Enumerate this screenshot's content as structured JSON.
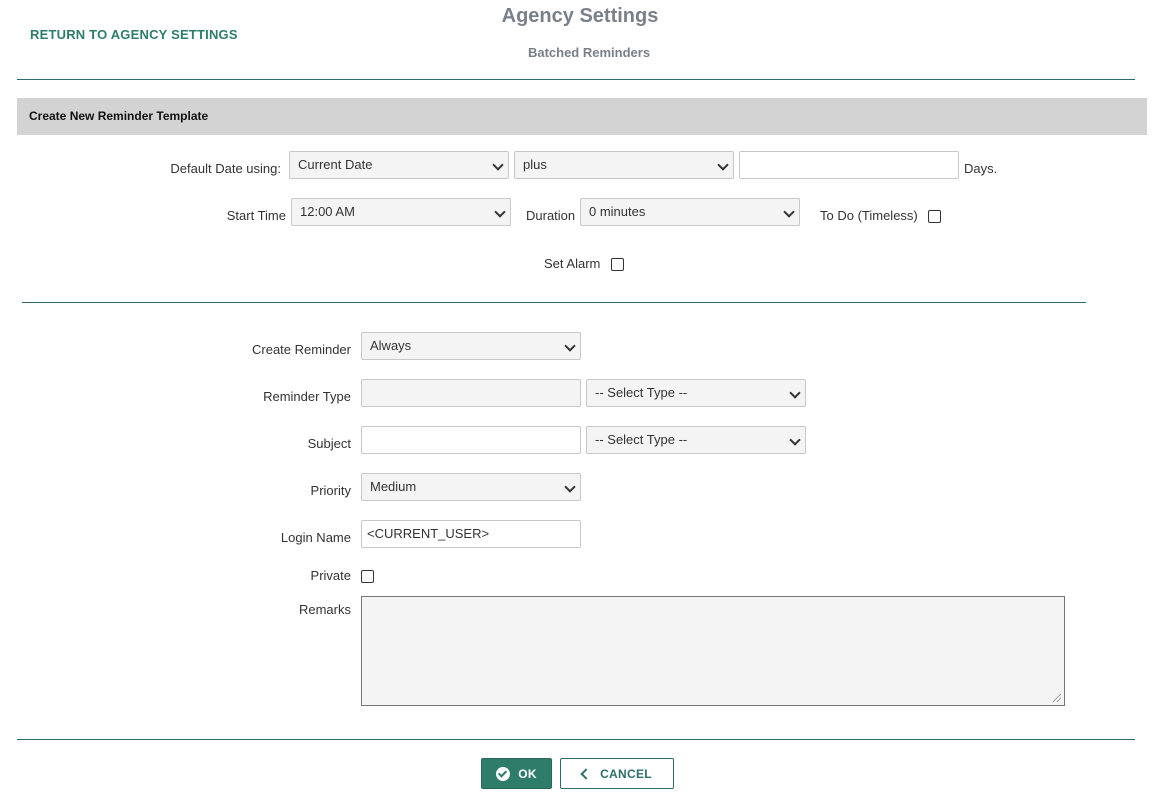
{
  "header": {
    "return_link": "RETURN TO AGENCY SETTINGS",
    "title": "Agency Settings",
    "subtitle": "Batched Reminders"
  },
  "section": {
    "title": "Create New Reminder Template"
  },
  "date_row": {
    "label": "Default Date using:",
    "date_source": "Current Date",
    "operator": "plus",
    "days_value": "",
    "days_suffix": "Days."
  },
  "time_row": {
    "start_label": "Start Time",
    "start_value": "12:00 AM",
    "duration_label": "Duration",
    "duration_value": "0 minutes",
    "todo_label": "To Do (Timeless)"
  },
  "alarm": {
    "label": "Set Alarm"
  },
  "form": {
    "create_reminder": {
      "label": "Create Reminder",
      "value": "Always"
    },
    "reminder_type": {
      "label": "Reminder Type",
      "text": "",
      "select": "-- Select Type --"
    },
    "subject": {
      "label": "Subject",
      "text": "",
      "select": "-- Select Type --"
    },
    "priority": {
      "label": "Priority",
      "value": "Medium"
    },
    "login_name": {
      "label": "Login Name",
      "value": "<CURRENT_USER>"
    },
    "private": {
      "label": "Private"
    },
    "remarks": {
      "label": "Remarks",
      "value": ""
    }
  },
  "actions": {
    "ok": "OK",
    "cancel": "CANCEL"
  },
  "colors": {
    "accent": "#2e7d6a",
    "rule": "#2e6e6a",
    "section_bg": "#d3d3d3",
    "title": "#7a8089"
  }
}
